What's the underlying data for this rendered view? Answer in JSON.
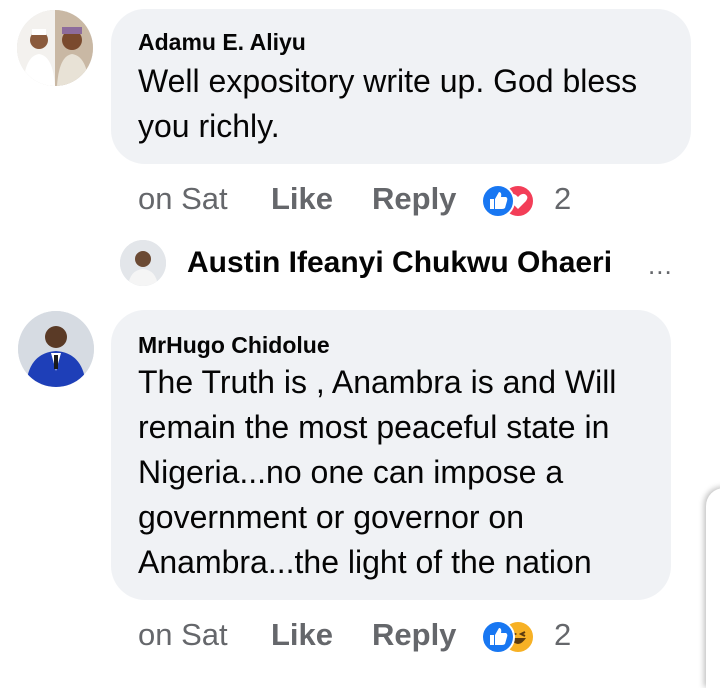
{
  "comments": [
    {
      "author": "Adamu E. Aliyu",
      "text": "Well expository write up. God bless\nyou richly.",
      "time": "on Sat",
      "like_label": "Like",
      "reply_label": "Reply",
      "reactions": [
        "like",
        "love"
      ],
      "reaction_count": "2"
    },
    {
      "author": "MrHugo Chidolue",
      "text": "The Truth is , Anambra is and Will\nremain the most peaceful state in\nNigeria...no one can impose a\ngovernment or governor on\nAnambra...the light of the nation",
      "time": "on Sat",
      "like_label": "Like",
      "reply_label": "Reply",
      "reactions": [
        "like",
        "haha"
      ],
      "reaction_count": "2"
    }
  ],
  "reply_preview": {
    "author": "Austin Ifeanyi Chukwu Ohaeri",
    "more": "..."
  },
  "colors": {
    "bubble": "#f0f2f5",
    "meta_text": "#65676b",
    "like_blue": "#1877f2",
    "love_red": "#f33e58",
    "haha_yellow": "#f7b125"
  }
}
